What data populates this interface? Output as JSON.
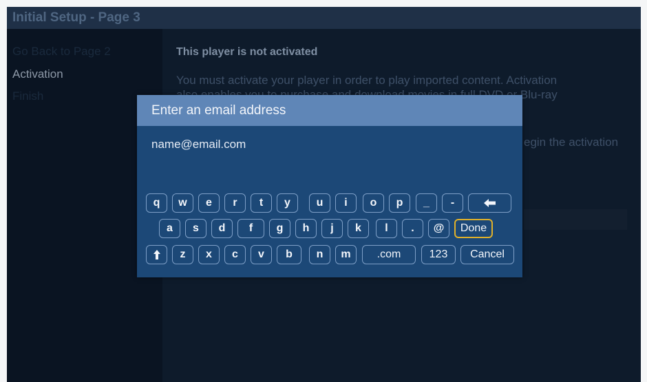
{
  "header": {
    "title": "Initial Setup - Page 3"
  },
  "sidebar": {
    "items": [
      {
        "label": "Go Back to Page 2"
      },
      {
        "label": "Activation"
      },
      {
        "label": "Finish"
      }
    ]
  },
  "content": {
    "heading": "This player is not activated",
    "body_line1": "You must activate your player in order to play imported content.  Activation",
    "body_line2": "also enables you to purchase and download movies in full DVD or Blu-ray",
    "body_right": "egin the activation"
  },
  "dialog": {
    "title": "Enter an email address",
    "input_value": "name@email.com",
    "keyboard": {
      "row1": [
        "q",
        "w",
        "e",
        "r",
        "t",
        "y",
        "u",
        "i",
        "o",
        "p",
        "_",
        "-"
      ],
      "row2": [
        "a",
        "s",
        "d",
        "f",
        "g",
        "h",
        "j",
        "k",
        "l",
        "."
      ],
      "row3": [
        "z",
        "x",
        "c",
        "v",
        "b",
        "n",
        "m"
      ],
      "at_key": "@",
      "done_key": "Done",
      "dotcom_key": ".com",
      "num_key": "123",
      "cancel_key": "Cancel",
      "backspace_icon": "left-arrow-icon",
      "shift_icon": "shift-up-arrow-icon"
    }
  },
  "colors": {
    "dialog_bg": "#1c4877",
    "dialog_header": "#5f86b7",
    "focus_outline": "#e1b12a"
  }
}
